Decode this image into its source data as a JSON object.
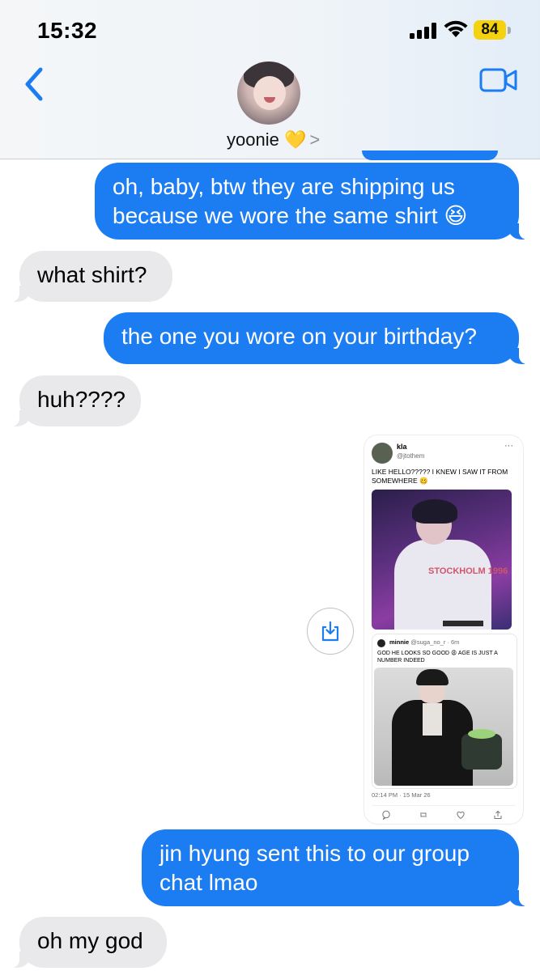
{
  "status_bar": {
    "time": "15:32",
    "battery": "84",
    "battery_color": "#f5d20f"
  },
  "header": {
    "contact_name": "yoonie 💛",
    "chevron": ">",
    "back_icon": "chevron-left-icon",
    "video_icon": "video-camera-icon"
  },
  "messages": [
    {
      "direction": "outgoing",
      "text": "oh, baby, btw they are shipping us because we wore the same shirt 😆"
    },
    {
      "direction": "incoming",
      "text": "what shirt?"
    },
    {
      "direction": "outgoing",
      "text": "the one you wore on your birthday?"
    },
    {
      "direction": "incoming",
      "text": "huh????"
    },
    {
      "direction": "outgoing",
      "text": "jin hyung sent this to our group chat lmao"
    },
    {
      "direction": "incoming",
      "text": "oh my god"
    }
  ],
  "shared_image": {
    "tweet": {
      "name": "kla",
      "handle": "@jtothem",
      "more": "···",
      "text": "LIKE HELLO????? I KNEW I SAW IT FROM SOMEWHERE 🥴",
      "photo_print": "STOCKHOLM 1996",
      "quoted": {
        "name": "minnie",
        "handle": "@suga_no_r · 6m",
        "text": "GOD HE LOOKS SO GOOD 😩 AGE IS JUST A NUMBER INDEED"
      },
      "date": "02:14 PM · 15 Mar 26"
    }
  },
  "colors": {
    "outgoing_bubble": "#1c7cf2",
    "incoming_bubble": "#e9e9eb",
    "accent": "#1c7cf2"
  }
}
